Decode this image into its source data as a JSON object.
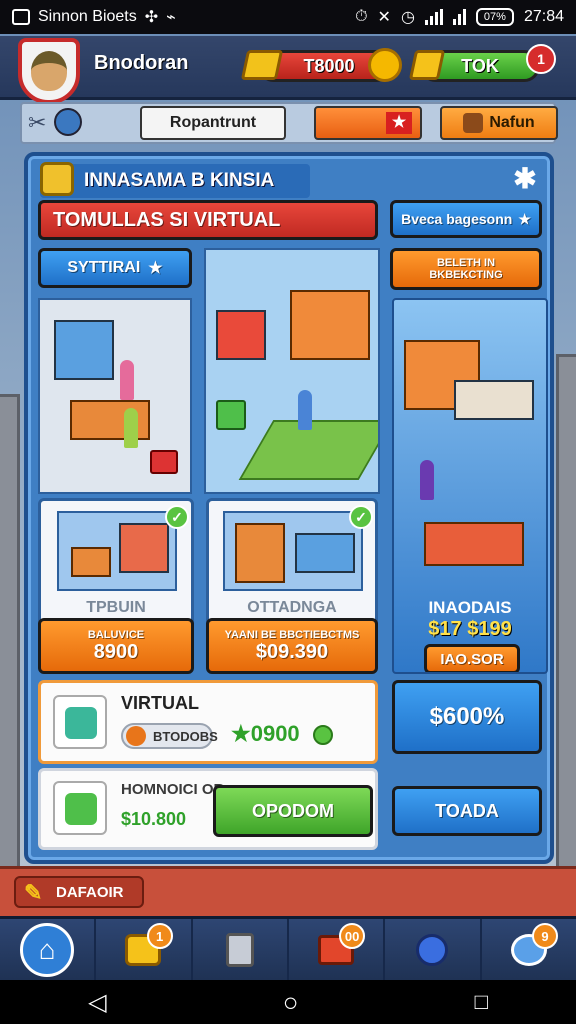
{
  "status_bar": {
    "carrier": "Sinnon Bioets",
    "time": "27:84",
    "battery": "07%"
  },
  "header": {
    "player_name": "Bnodoran",
    "currency_value": "T8000",
    "premium_label": "TOK",
    "notification_count": "1"
  },
  "sub_bar": {
    "location_label": "Ropantrunt",
    "action_label": "Nafun"
  },
  "panel": {
    "title": "INNASAMA B KINSIA",
    "banner": "TOMULLAS SI VIRTUAL",
    "browse_button": "Bveca bagesonn",
    "tab_label": "SYTTIRAI",
    "side_button": "BELETH IN BKBEKCTING",
    "cards": [
      {
        "label": "TPBUIN",
        "badge": "BALUVICE",
        "price": "8900"
      },
      {
        "label": "OTTADNGA",
        "badge": "YAANI BE BBCTIEBCTMS",
        "price": "$09.390"
      }
    ],
    "right_card": {
      "label": "INAODAIS",
      "price": "$17 $199",
      "button": "IAO.SOR"
    },
    "big_button": "$600%",
    "bottom_button": "TOADA",
    "list_rows": [
      {
        "title": "VIRTUAL",
        "pill": "BTODOBS",
        "value": "★0900"
      },
      {
        "title": "HOMNOICI OR",
        "value": "$10.800",
        "button": "OPODOM"
      }
    ]
  },
  "footer": {
    "tag_label": "DAFAOIR"
  },
  "navbar": {
    "badges": [
      "1",
      "00",
      "9"
    ]
  },
  "colors": {
    "panel_blue": "#3f7fc4",
    "accent_orange": "#ff9a2e",
    "accent_red": "#e8463b",
    "accent_green": "#7ed957"
  }
}
